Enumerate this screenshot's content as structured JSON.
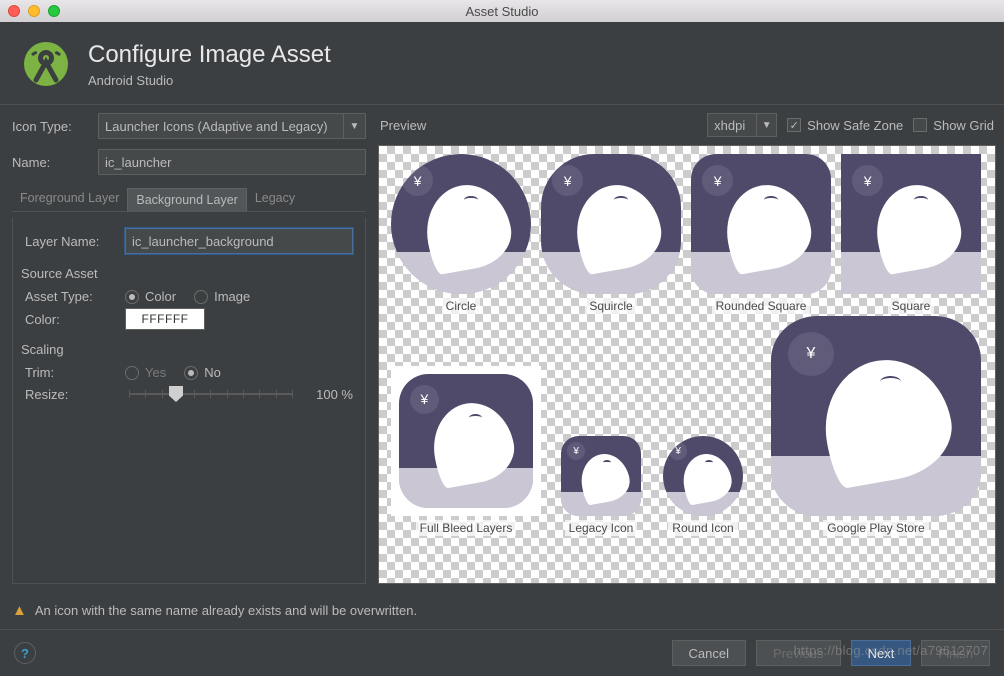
{
  "window": {
    "title": "Asset Studio"
  },
  "header": {
    "title": "Configure Image Asset",
    "subtitle": "Android Studio"
  },
  "form": {
    "icon_type_label": "Icon Type:",
    "icon_type_value": "Launcher Icons (Adaptive and Legacy)",
    "name_label": "Name:",
    "name_value": "ic_launcher",
    "tabs": {
      "foreground": "Foreground Layer",
      "background": "Background Layer",
      "legacy": "Legacy"
    },
    "layer_name_label": "Layer Name:",
    "layer_name_value": "ic_launcher_background",
    "source_asset_label": "Source Asset",
    "asset_type_label": "Asset Type:",
    "asset_type": {
      "color": "Color",
      "image": "Image"
    },
    "color_label": "Color:",
    "color_value": "FFFFFF",
    "scaling_label": "Scaling",
    "trim_label": "Trim:",
    "trim": {
      "yes": "Yes",
      "no": "No"
    },
    "resize_label": "Resize:",
    "resize_value": "100 %"
  },
  "preview": {
    "label": "Preview",
    "density": "xhdpi",
    "show_safe_zone": "Show Safe Zone",
    "show_grid": "Show Grid",
    "items": {
      "circle": "Circle",
      "squircle": "Squircle",
      "rounded_square": "Rounded Square",
      "square": "Square",
      "full_bleed": "Full Bleed Layers",
      "legacy_icon": "Legacy Icon",
      "round_icon": "Round Icon",
      "play_store": "Google Play Store"
    },
    "badge_glyph": "¥"
  },
  "warning": "An icon with the same name already exists and will be overwritten.",
  "buttons": {
    "cancel": "Cancel",
    "previous": "Previous",
    "next": "Next",
    "finish": "Finish"
  },
  "watermark": "https://blog.csdn.net/a79612707"
}
